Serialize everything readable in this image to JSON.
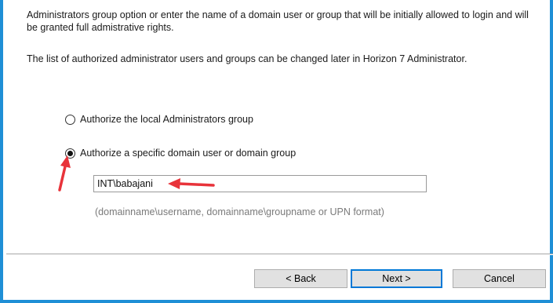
{
  "description": {
    "line1": "Administrators group option or enter the name of a domain user or group that will be initially allowed to login and will be granted full admistrative rights.",
    "line2": "The list of authorized administrator users and groups can be changed later in Horizon 7 Administrator."
  },
  "options": [
    {
      "label": "Authorize the local Administrators group",
      "selected": false
    },
    {
      "label": "Authorize a specific domain user or domain group",
      "selected": true
    }
  ],
  "account_input": {
    "value": "INT\\babajani"
  },
  "hint": "(domainname\\username, domainname\\groupname or UPN format)",
  "buttons": {
    "back": "< Back",
    "next": "Next >",
    "cancel": "Cancel"
  },
  "colors": {
    "window_border": "#1f8fd6",
    "annotation_arrow": "#e8333a"
  }
}
